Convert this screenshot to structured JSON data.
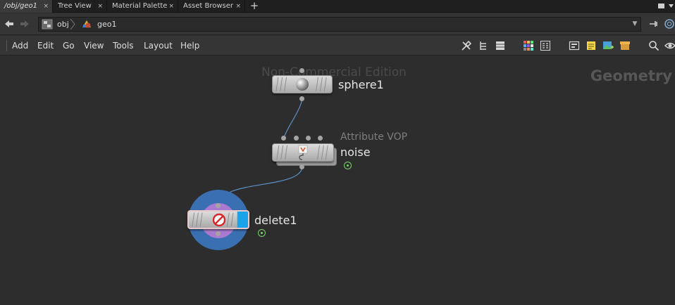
{
  "tabs": [
    {
      "label": "/obj/geo1",
      "active": true
    },
    {
      "label": "Tree View",
      "active": false
    },
    {
      "label": "Material Palette",
      "active": false
    },
    {
      "label": "Asset Browser",
      "active": false
    }
  ],
  "tab_close_glyph": "×",
  "tab_add_glyph": "+",
  "path": {
    "crumb1": "obj",
    "crumb2": "geo1",
    "dropdown_glyph": "▼"
  },
  "menu": {
    "add": "Add",
    "edit": "Edit",
    "go": "Go",
    "view": "View",
    "tools": "Tools",
    "layout": "Layout",
    "help": "Help"
  },
  "canvas": {
    "watermark": "Non-Commercial Edition",
    "context_label": "Geometry"
  },
  "nodes": {
    "sphere": {
      "name": "sphere1",
      "icon": "sphere-icon"
    },
    "noise": {
      "name": "noise",
      "type_label": "Attribute VOP",
      "icon": "vop-icon"
    },
    "delete": {
      "name": "delete1",
      "icon": "delete-icon"
    }
  },
  "colors": {
    "display_flag": "#1aa3e8",
    "selection_halo": "#3a6fb2",
    "template_halo": "#a97ad0",
    "wire": "#5d8fc4",
    "flag_green": "#7cd36a"
  }
}
